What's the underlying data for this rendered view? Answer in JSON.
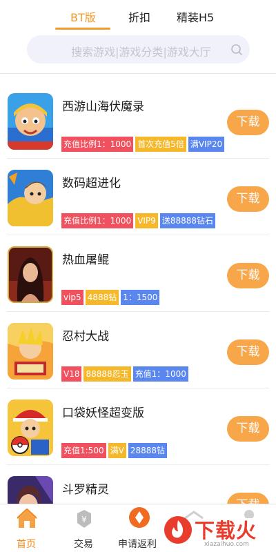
{
  "top_tabs": [
    {
      "label": "BT版",
      "active": true
    },
    {
      "label": "折扣",
      "active": false
    },
    {
      "label": "精装H5",
      "active": false
    }
  ],
  "search": {
    "placeholder": "搜索游戏|游戏分类|游戏大厅",
    "icon": "search-icon"
  },
  "download_label": "下载",
  "games": [
    {
      "name": "西游山海伏魔录",
      "icon": "monkey-king-game-icon",
      "tags": [
        {
          "text": "充值比例1：1000",
          "color": "#f1505e"
        },
        {
          "text": "首次充值5倍",
          "color": "#f5b82b"
        },
        {
          "text": "满VIP20",
          "color": "#5a86f0"
        }
      ]
    },
    {
      "name": "数码超进化",
      "icon": "digimon-game-icon",
      "tags": [
        {
          "text": "充值比例1：1000",
          "color": "#f1505e"
        },
        {
          "text": "VIP9",
          "color": "#f5b82b"
        },
        {
          "text": "送88888钻石",
          "color": "#5a86f0"
        }
      ]
    },
    {
      "name": "热血屠鲲",
      "icon": "warrior-woman-game-icon",
      "tags": [
        {
          "text": "vip5",
          "color": "#f1505e"
        },
        {
          "text": "4888钻",
          "color": "#f5b82b"
        },
        {
          "text": "1：1500",
          "color": "#5a86f0"
        }
      ]
    },
    {
      "name": "忍村大战",
      "icon": "ninja-game-icon",
      "tags": [
        {
          "text": "V18",
          "color": "#f1505e"
        },
        {
          "text": "88888忍玉",
          "color": "#f5b82b"
        },
        {
          "text": "充值1：1000",
          "color": "#5a86f0"
        }
      ]
    },
    {
      "name": "口袋妖怪超变版",
      "icon": "pokemon-trainer-game-icon",
      "tags": [
        {
          "text": "充值1:500",
          "color": "#f1505e"
        },
        {
          "text": "满V",
          "color": "#f5b82b"
        },
        {
          "text": "28888钻",
          "color": "#5a86f0"
        }
      ]
    },
    {
      "name": "斗罗精灵",
      "icon": "spirit-girl-game-icon",
      "tags": []
    }
  ],
  "bottom_nav": [
    {
      "label": "首页",
      "icon": "home-icon",
      "active": true
    },
    {
      "label": "交易",
      "icon": "trade-yen-icon",
      "active": false
    },
    {
      "label": "申请返利",
      "icon": "rebate-icon",
      "active": false
    }
  ],
  "watermark": {
    "text": "下载火",
    "url": "xiazaihuo.com"
  },
  "colors": {
    "accent": "#f09a2a",
    "download": "#f7a64a",
    "tag_red": "#f1505e",
    "tag_yellow": "#f5b82b",
    "tag_blue": "#5a86f0"
  }
}
